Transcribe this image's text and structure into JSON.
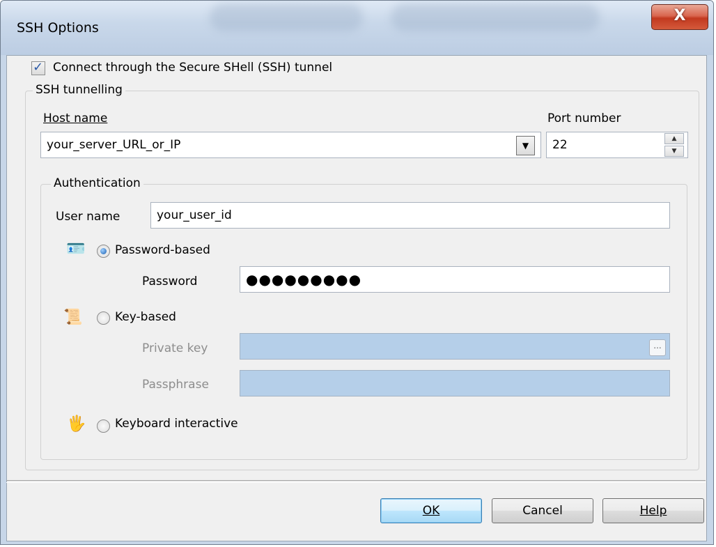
{
  "window": {
    "title": "SSH Options",
    "close_label": "X"
  },
  "connect": {
    "checked": true,
    "label": "Connect through the Secure SHell (SSH) tunnel"
  },
  "tunnel": {
    "legend": "SSH tunnelling",
    "host_label": "Host name",
    "host_value": "your_server_URL_or_IP",
    "port_label": "Port number",
    "port_value": "22"
  },
  "auth": {
    "legend": "Authentication",
    "user_label": "User name",
    "user_value": "your_user_id",
    "password_based": {
      "label": "Password-based",
      "selected": true,
      "icon": "id-card-icon"
    },
    "password_label": "Password",
    "password_value": "●●●●●●●●●",
    "key_based": {
      "label": "Key-based",
      "selected": false,
      "icon": "certificate-icon"
    },
    "private_key_label": "Private key",
    "private_key_value": "",
    "browse_label": "...",
    "passphrase_label": "Passphrase",
    "passphrase_value": "",
    "keyboard": {
      "label": "Keyboard interactive",
      "selected": false,
      "icon": "keyboard-hand-icon"
    }
  },
  "buttons": {
    "ok": "OK",
    "cancel": "Cancel",
    "help": "Help"
  }
}
